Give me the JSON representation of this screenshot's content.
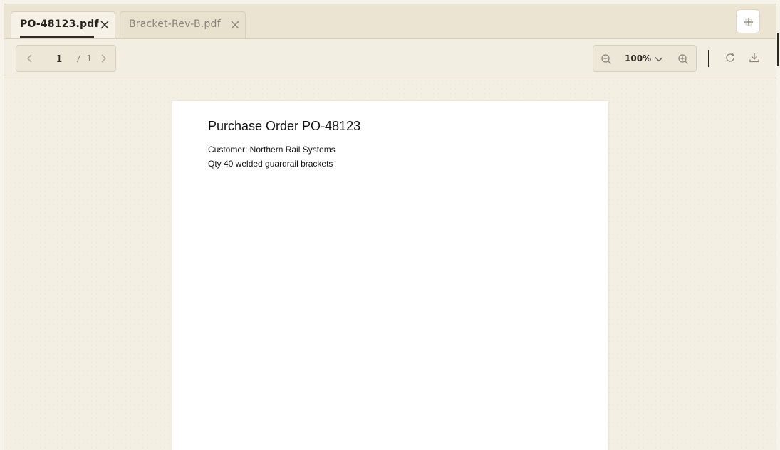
{
  "tabs": [
    {
      "label": "PO-48123.pdf",
      "active": true,
      "close_icon": "close-icon"
    },
    {
      "label": "Bracket-Rev-B.pdf",
      "active": false,
      "close_icon": "close-icon"
    }
  ],
  "new_tab_icon": "plus-icon",
  "toolbar": {
    "page_current": "1",
    "page_total": "/ 1",
    "zoom": "100%",
    "icons": [
      "chevron-left-icon",
      "chevron-right-icon",
      "zoom-out-icon",
      "chevron-down-icon",
      "zoom-in-icon",
      "rotate-icon",
      "download-icon"
    ]
  },
  "document": {
    "title": "Purchase Order PO-48123",
    "lines": [
      "Customer: Northern Rail Systems",
      "Qty 40 welded guardrail brackets"
    ]
  },
  "colors": {
    "background": "#f3efe3",
    "tabbar": "#ebe4d2",
    "text_dark": "#26221d",
    "text_muted": "#8a8377"
  }
}
